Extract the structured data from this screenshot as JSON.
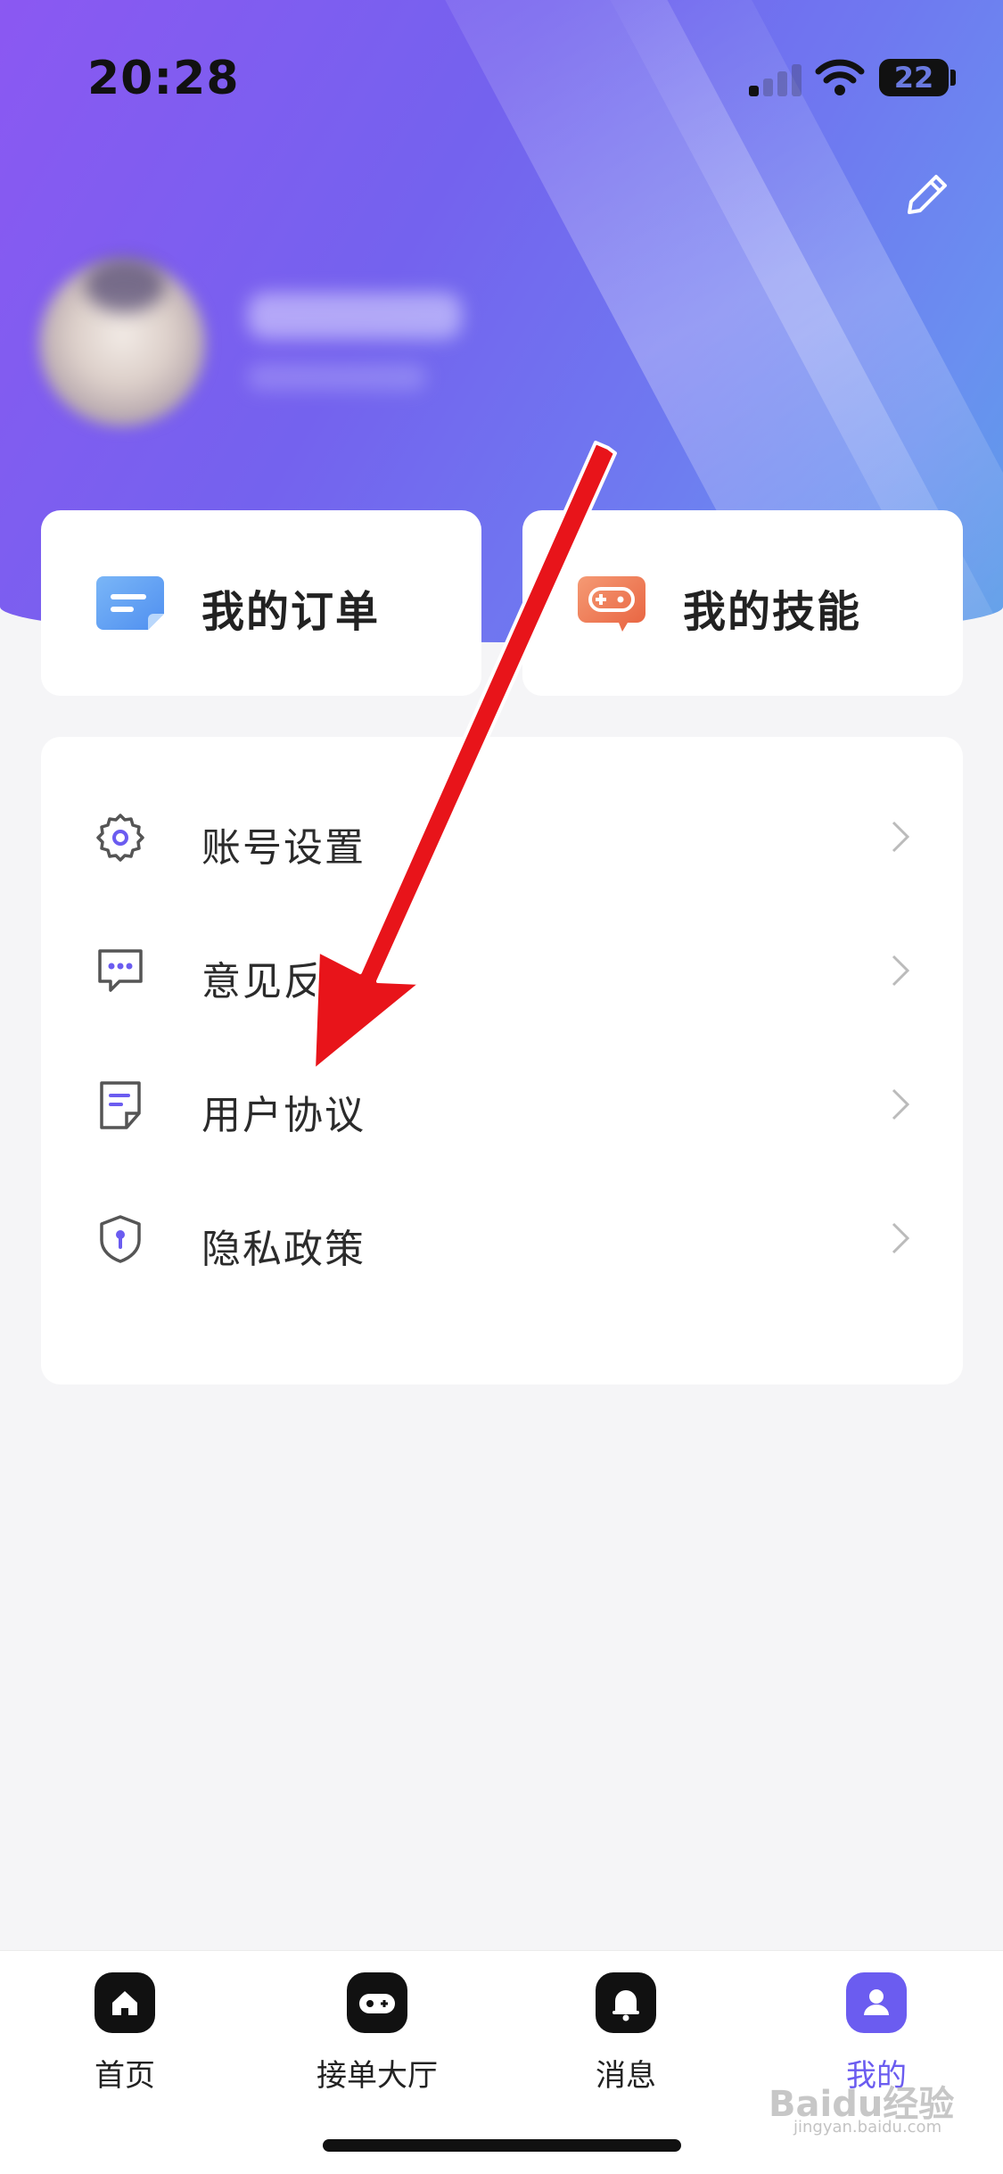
{
  "status_bar": {
    "time": "20:28",
    "battery": "22"
  },
  "header": {
    "edit_icon": "pencil-icon"
  },
  "quick_cards": [
    {
      "label": "我的订单",
      "icon": "order-list-icon",
      "color": "#5b9cf2"
    },
    {
      "label": "我的技能",
      "icon": "gamepad-chat-icon",
      "color": "#ee7a54"
    }
  ],
  "menu": [
    {
      "label": "账号设置",
      "icon": "gear-icon"
    },
    {
      "label": "意见反",
      "icon": "feedback-chat-icon"
    },
    {
      "label": "用户协议",
      "icon": "document-icon"
    },
    {
      "label": "隐私政策",
      "icon": "shield-key-icon"
    }
  ],
  "tabs": [
    {
      "label": "首页",
      "icon": "home-icon",
      "active": false
    },
    {
      "label": "接单大厅",
      "icon": "gamepad-icon",
      "active": false
    },
    {
      "label": "消息",
      "icon": "bell-icon",
      "active": false
    },
    {
      "label": "我的",
      "icon": "person-icon",
      "active": true
    }
  ],
  "colors": {
    "accent": "#6b5cf0",
    "arrow": "#e8141a"
  },
  "watermark": {
    "text": "Baidu经验",
    "sub": "jingyan.baidu.com"
  }
}
